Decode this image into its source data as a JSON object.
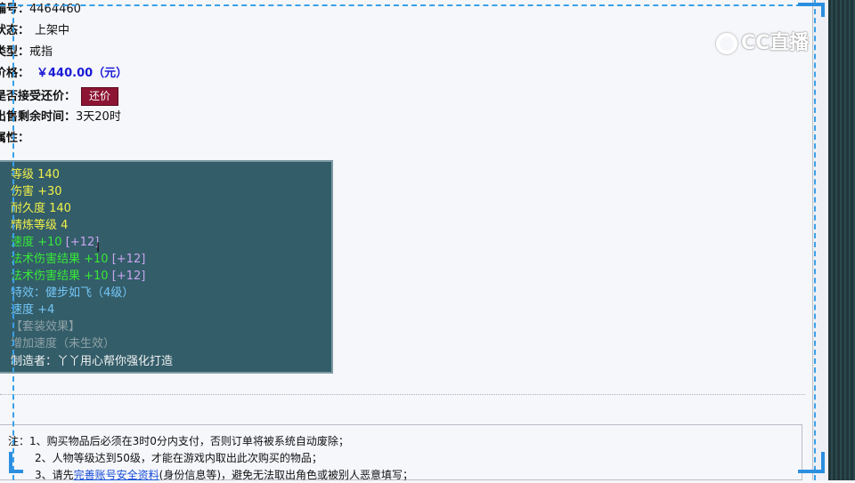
{
  "info": {
    "id_label": "编号：",
    "id_value": "4464460",
    "status_label": "状态：",
    "status_value": "上架中",
    "type_label": "类型：",
    "type_value": "戒指",
    "price_label": "价格：",
    "price_value": "￥440.00（元）",
    "bargain_label": "是否接受还价：",
    "bargain_button": "还价",
    "time_label": "出售剩余时间：",
    "time_value": "3天20时",
    "attr_label": "属性："
  },
  "attributes": [
    {
      "text": "等级 140",
      "color": "yellow"
    },
    {
      "text": "伤害 +30",
      "color": "yellow"
    },
    {
      "text": "耐久度 140",
      "color": "yellow"
    },
    {
      "text": "精炼等级 4",
      "color": "yellow"
    },
    {
      "text": "速度 +10",
      "extra": "[+12]",
      "color": "green"
    },
    {
      "text": "法术伤害结果 +10",
      "extra": "[+12]",
      "color": "green"
    },
    {
      "text": "法术伤害结果 +10",
      "extra": "[+12]",
      "color": "green"
    },
    {
      "text": "特效：健步如飞（4级）",
      "color": "blue"
    },
    {
      "text": "速度 +4",
      "color": "blue"
    },
    {
      "text": "【套装效果】",
      "color": "gray"
    },
    {
      "text": "增加速度（未生效）",
      "color": "gray"
    },
    {
      "text": "制造者：丫丫用心帮你强化打造",
      "color": "white"
    }
  ],
  "notes": {
    "prefix": "注：",
    "n1": "1、购买物品后必须在3时0分内支付，否则订单将被系统自动废除；",
    "n2": "2、人物等级达到50级，才能在游戏内取出此次购买的物品；",
    "n3_a": "3、请先",
    "n3_link": "完善账号安全资料",
    "n3_b": "(身份信息等)，避免无法取出角色或被别人恶意填写；"
  },
  "watermark": {
    "text": "CC直播",
    "icon": "cc-logo-icon"
  },
  "colors": {
    "attr_bg": "#335d69",
    "button_bg": "#8b1532",
    "price": "#1a1ad6",
    "accent_dash": "#3aa0e8"
  }
}
